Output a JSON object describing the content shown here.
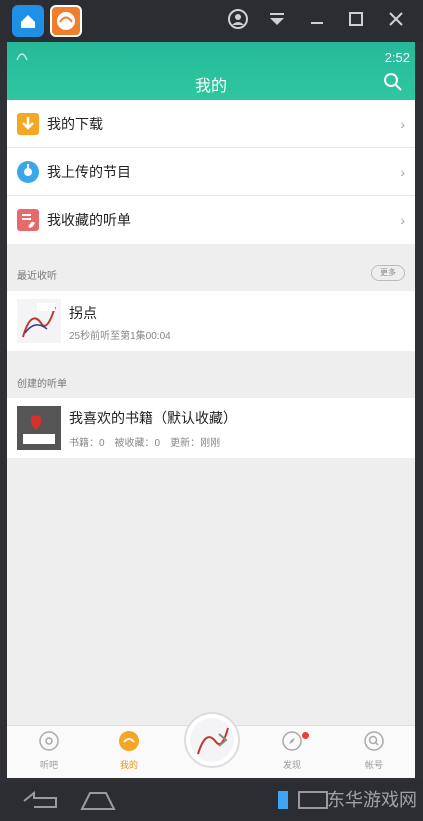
{
  "status": {
    "time": "2:52"
  },
  "header": {
    "title": "我的"
  },
  "menu": [
    {
      "label": "我的下载",
      "icon": "download-icon",
      "color": "#f5a623"
    },
    {
      "label": "我上传的节目",
      "icon": "upload-disc-icon",
      "color": "#3aa7e8"
    },
    {
      "label": "我收藏的听单",
      "icon": "favorites-list-icon",
      "color": "#e66a6a"
    }
  ],
  "recent": {
    "section": "最近收听",
    "more": "更多",
    "item": {
      "title": "拐点",
      "subtitle": "25秒前听至第1集00:04"
    }
  },
  "created": {
    "section": "创建的听单",
    "item": {
      "title": "我喜欢的书籍（默认收藏）",
      "meta": "书籍：0　被收藏：0　更新：刚刚"
    }
  },
  "tabs": [
    {
      "label": "听吧",
      "icon": "listen-icon"
    },
    {
      "label": "我的",
      "icon": "mine-icon",
      "active": true
    },
    {
      "label": "发现",
      "icon": "compass-icon",
      "badge": true
    },
    {
      "label": "帐号",
      "icon": "account-search-icon"
    }
  ],
  "watermark": "东华游戏网"
}
